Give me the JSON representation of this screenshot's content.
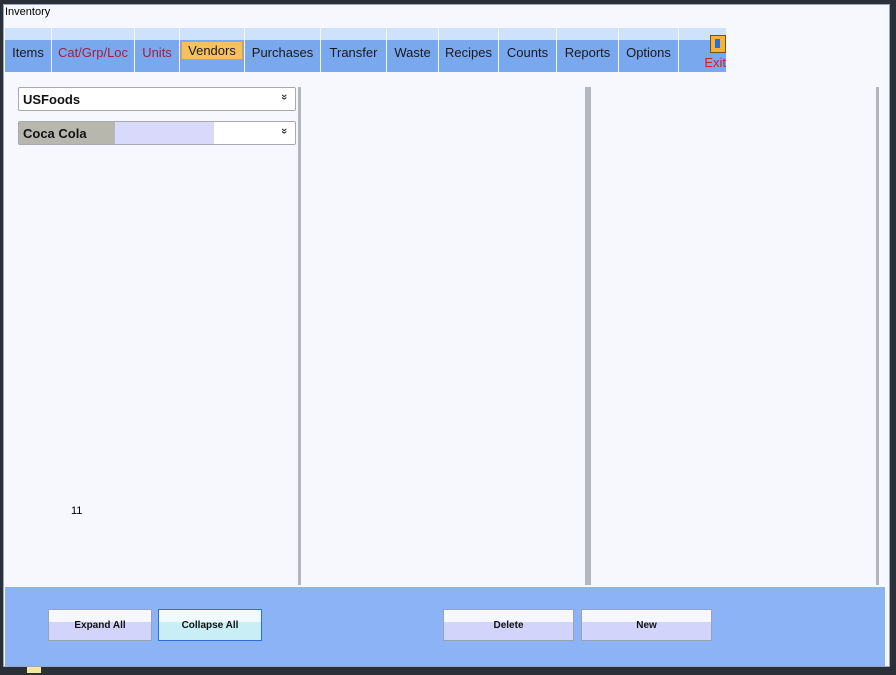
{
  "window": {
    "title": "Inventory"
  },
  "tabs": [
    {
      "label": "Items"
    },
    {
      "label": "Cat/Grp/Loc"
    },
    {
      "label": "Units"
    },
    {
      "label": "Vendors"
    },
    {
      "label": "Purchases"
    },
    {
      "label": "Transfer"
    },
    {
      "label": "Waste"
    },
    {
      "label": "Recipes"
    },
    {
      "label": "Counts"
    },
    {
      "label": "Reports"
    },
    {
      "label": "Options"
    },
    {
      "label": "Exit"
    }
  ],
  "vendor_select": {
    "value": "USFoods",
    "icon": "chevron-double-down-icon"
  },
  "item_select": {
    "value": "Coca Cola",
    "icon": "chevron-double-down-icon"
  },
  "left_panel": {
    "count": "11"
  },
  "buttons": {
    "expand_all": "Expand All",
    "collapse_all": "Collapse All",
    "delete": "Delete",
    "new": "New"
  },
  "colors": {
    "tab_bar": "#7aa8ef",
    "active_tab": "#f6c05e",
    "bottom_bar": "#8bb3f5"
  }
}
